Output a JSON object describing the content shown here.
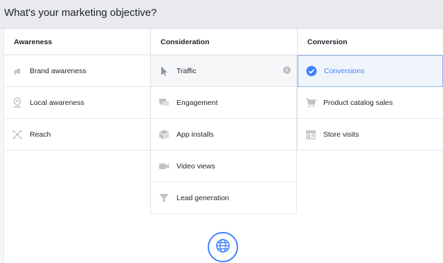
{
  "header": {
    "title": "What's your marketing objective?"
  },
  "columns": [
    {
      "title": "Awareness",
      "items": [
        {
          "label": "Brand awareness",
          "icon": "megaphone-icon"
        },
        {
          "label": "Local awareness",
          "icon": "location-pin-icon"
        },
        {
          "label": "Reach",
          "icon": "network-icon"
        }
      ]
    },
    {
      "title": "Consideration",
      "items": [
        {
          "label": "Traffic",
          "icon": "cursor-icon",
          "info": "i"
        },
        {
          "label": "Engagement",
          "icon": "chat-bubbles-icon"
        },
        {
          "label": "App installs",
          "icon": "box-icon"
        },
        {
          "label": "Video views",
          "icon": "video-camera-icon"
        },
        {
          "label": "Lead generation",
          "icon": "funnel-icon"
        }
      ]
    },
    {
      "title": "Conversion",
      "items": [
        {
          "label": "Conversions",
          "icon": "checkmark-circle-icon"
        },
        {
          "label": "Product catalog sales",
          "icon": "shopping-cart-icon"
        },
        {
          "label": "Store visits",
          "icon": "store-icon"
        }
      ]
    }
  ],
  "colors": {
    "accent": "#4080ff",
    "icon_gray": "#bec3c9",
    "selected_bg": "#f0f5fc"
  }
}
